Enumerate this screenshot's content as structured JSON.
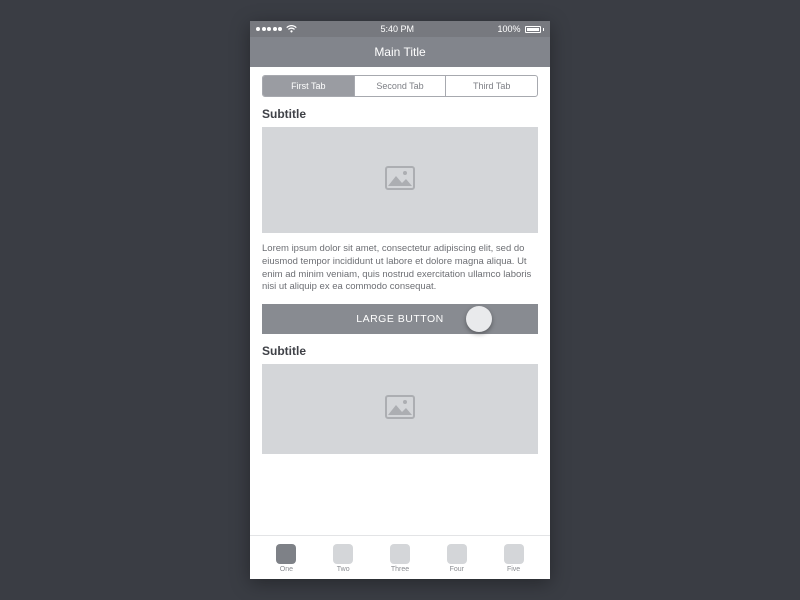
{
  "status": {
    "time": "5:40 PM",
    "battery": "100%"
  },
  "nav": {
    "title": "Main Title"
  },
  "tabs": {
    "items": [
      {
        "label": "First Tab"
      },
      {
        "label": "Second Tab"
      },
      {
        "label": "Third Tab"
      }
    ]
  },
  "section1": {
    "subtitle": "Subtitle",
    "body": "Lorem ipsum dolor sit amet, consectetur adipiscing elit, sed do eiusmod tempor incididunt ut labore et dolore magna aliqua. Ut enim ad minim veniam, quis nostrud exercitation ullamco laboris nisi ut aliquip ex ea commodo consequat.",
    "cta": "LARGE BUTTON"
  },
  "section2": {
    "subtitle": "Subtitle"
  },
  "bottom_tabs": {
    "items": [
      {
        "label": "One"
      },
      {
        "label": "Two"
      },
      {
        "label": "Three"
      },
      {
        "label": "Four"
      },
      {
        "label": "Five"
      }
    ]
  }
}
